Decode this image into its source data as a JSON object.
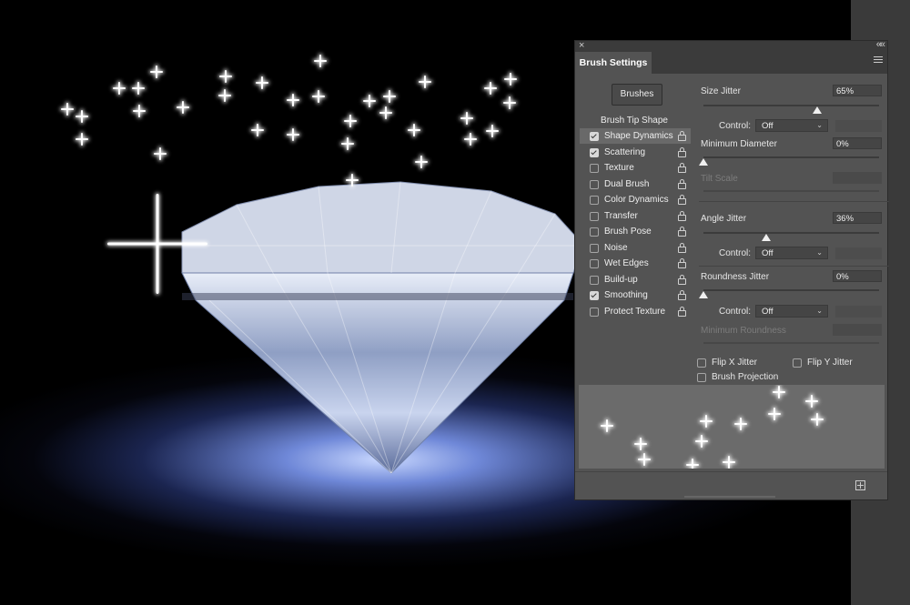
{
  "panel": {
    "close_icon": "×",
    "collapse_icon": "««",
    "tab_title": "Brush Settings",
    "brushes_button": "Brushes",
    "tip_shape_label": "Brush Tip Shape",
    "options": [
      {
        "label": "Shape Dynamics",
        "checked": true,
        "active": true
      },
      {
        "label": "Scattering",
        "checked": true,
        "active": false
      },
      {
        "label": "Texture",
        "checked": false,
        "active": false
      },
      {
        "label": "Dual Brush",
        "checked": false,
        "active": false
      },
      {
        "label": "Color Dynamics",
        "checked": false,
        "active": false
      },
      {
        "label": "Transfer",
        "checked": false,
        "active": false
      },
      {
        "label": "Brush Pose",
        "checked": false,
        "active": false
      },
      {
        "label": "Noise",
        "checked": false,
        "active": false
      },
      {
        "label": "Wet Edges",
        "checked": false,
        "active": false
      },
      {
        "label": "Build-up",
        "checked": false,
        "active": false
      },
      {
        "label": "Smoothing",
        "checked": true,
        "active": false
      },
      {
        "label": "Protect Texture",
        "checked": false,
        "active": false
      }
    ],
    "size_jitter": {
      "label": "Size Jitter",
      "value": "65%",
      "level": 0.65
    },
    "size_control": {
      "label": "Control:",
      "value": "Off"
    },
    "minimum_diameter": {
      "label": "Minimum Diameter",
      "value": "0%",
      "level": 0
    },
    "tilt_scale": {
      "label": "Tilt Scale"
    },
    "angle_jitter": {
      "label": "Angle Jitter",
      "value": "36%",
      "level": 0.36
    },
    "angle_control": {
      "label": "Control:",
      "value": "Off"
    },
    "roundness_jitter": {
      "label": "Roundness Jitter",
      "value": "0%",
      "level": 0
    },
    "roundness_control": {
      "label": "Control:",
      "value": "Off"
    },
    "minimum_roundness": {
      "label": "Minimum Roundness"
    },
    "flip_x": {
      "label": "Flip X Jitter",
      "checked": false
    },
    "flip_y": {
      "label": "Flip Y Jitter",
      "checked": false
    },
    "brush_projection": {
      "label": "Brush Projection",
      "checked": false
    }
  },
  "icons": {
    "close": "close-icon",
    "collapse": "double-chevron-left-icon",
    "menu": "hamburger-menu-icon",
    "lock": "lock-icon",
    "new": "new-brush-icon",
    "dropdown": "chevron-down-icon"
  },
  "colors": {
    "panel_bg": "#535353",
    "active_row": "#696969",
    "workspace": "#3a3a3a"
  }
}
